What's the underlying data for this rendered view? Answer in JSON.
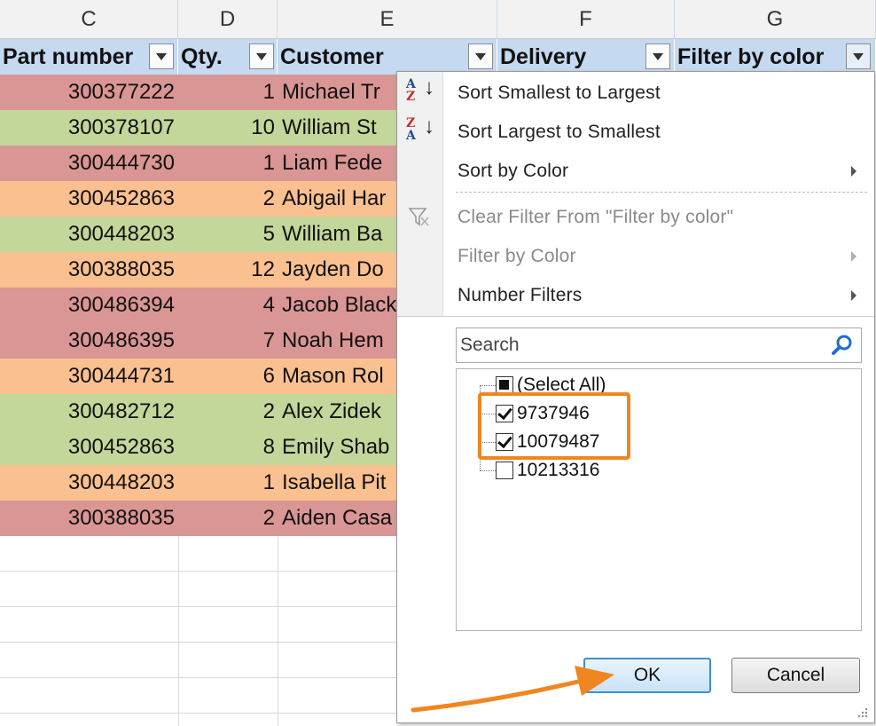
{
  "columns": {
    "letters": [
      "C",
      "D",
      "E",
      "F",
      "G"
    ],
    "headers": [
      "Part number",
      "Qty.",
      "Customer",
      "Delivery",
      "Filter by color"
    ]
  },
  "rows": [
    {
      "part": "300377222",
      "qty": "1",
      "customer": "Michael Tr",
      "color": "red"
    },
    {
      "part": "300378107",
      "qty": "10",
      "customer": "William St",
      "color": "green"
    },
    {
      "part": "300444730",
      "qty": "1",
      "customer": "Liam Fede",
      "color": "red"
    },
    {
      "part": "300452863",
      "qty": "2",
      "customer": "Abigail Har",
      "color": "orange"
    },
    {
      "part": "300448203",
      "qty": "5",
      "customer": "William Ba",
      "color": "green"
    },
    {
      "part": "300388035",
      "qty": "12",
      "customer": "Jayden Do",
      "color": "orange"
    },
    {
      "part": "300486394",
      "qty": "4",
      "customer": "Jacob Black",
      "color": "red"
    },
    {
      "part": "300486395",
      "qty": "7",
      "customer": "Noah Hem",
      "color": "red"
    },
    {
      "part": "300444731",
      "qty": "6",
      "customer": "Mason Rol",
      "color": "orange"
    },
    {
      "part": "300482712",
      "qty": "2",
      "customer": "Alex Zidek",
      "color": "green"
    },
    {
      "part": "300452863",
      "qty": "8",
      "customer": "Emily Shab",
      "color": "green"
    },
    {
      "part": "300448203",
      "qty": "1",
      "customer": "Isabella Pit",
      "color": "orange"
    },
    {
      "part": "300388035",
      "qty": "2",
      "customer": "Aiden Casa",
      "color": "red"
    }
  ],
  "colors": {
    "red": "#da9694",
    "green": "#c4d79b",
    "orange": "#fac090",
    "header": "#c5d9f1",
    "highlight": "#f0861f"
  },
  "menu": {
    "sort_asc": "Sort Smallest to Largest",
    "sort_desc": "Sort Largest to Smallest",
    "sort_color": "Sort by Color",
    "clear_filter": "Clear Filter From \"Filter by color\"",
    "filter_color": "Filter by Color",
    "number_filters": "Number Filters"
  },
  "sort_icons": {
    "asc_top": "A",
    "asc_bottom": "Z",
    "desc_top": "Z",
    "desc_bottom": "A"
  },
  "search": {
    "placeholder": "Search"
  },
  "filter_list": [
    {
      "label": "(Select All)",
      "state": "partial"
    },
    {
      "label": "9737946",
      "state": "checked"
    },
    {
      "label": "10079487",
      "state": "checked"
    },
    {
      "label": "10213316",
      "state": "unchecked"
    }
  ],
  "buttons": {
    "ok": "OK",
    "cancel": "Cancel"
  }
}
